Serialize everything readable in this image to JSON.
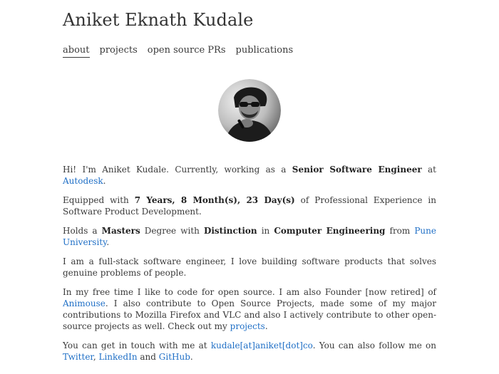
{
  "header": {
    "title": "Aniket Eknath Kudale"
  },
  "nav": [
    {
      "label": "about",
      "active": true
    },
    {
      "label": "projects",
      "active": false
    },
    {
      "label": "open source PRs",
      "active": false
    },
    {
      "label": "publications",
      "active": false
    }
  ],
  "avatar": {
    "icon": "profile-photo",
    "alt": ""
  },
  "intro": {
    "p1": {
      "t1": "Hi! I'm Aniket Kudale. Currently, working as a ",
      "b1": "Senior Software Engineer",
      "t2": " at ",
      "link": "Autodesk",
      "t3": "."
    },
    "p2": {
      "t1": "Equipped with ",
      "b1": "7 Years, 8 Month(s), 23 Day(s)",
      "t2": " of Professional Experience in Software Product Development."
    },
    "p3": {
      "t1": "Holds a ",
      "b1": "Masters",
      "t2": " Degree with ",
      "b2": "Distinction",
      "t3": " in ",
      "b3": "Computer Engineering",
      "t4": " from ",
      "link": "Pune University",
      "t5": "."
    },
    "p4": {
      "t1": "I am a full-stack software engineer, I love building software products that solves genuine problems of people."
    },
    "p5": {
      "t1": "In my free time I like to code for open source. I am also Founder [now retired] of ",
      "link1": "Animouse",
      "t2": ". I also contribute to Open Source Projects, made some of my major contributions to Mozilla Firefox and VLC and also I actively contribute to other open-source projects as well. Check out my ",
      "link2": "projects",
      "t3": "."
    },
    "p6": {
      "t1": "You can get in touch with me at ",
      "link1": "kudale[at]aniket[dot]co",
      "t2": ". You can also follow me on ",
      "link2": "Twitter",
      "t3": ", ",
      "link3": "LinkedIn",
      "t4": " and ",
      "link4": "GitHub",
      "t5": "."
    }
  },
  "colors": {
    "link": "#1f6fc6",
    "text": "#3a3a3a"
  }
}
